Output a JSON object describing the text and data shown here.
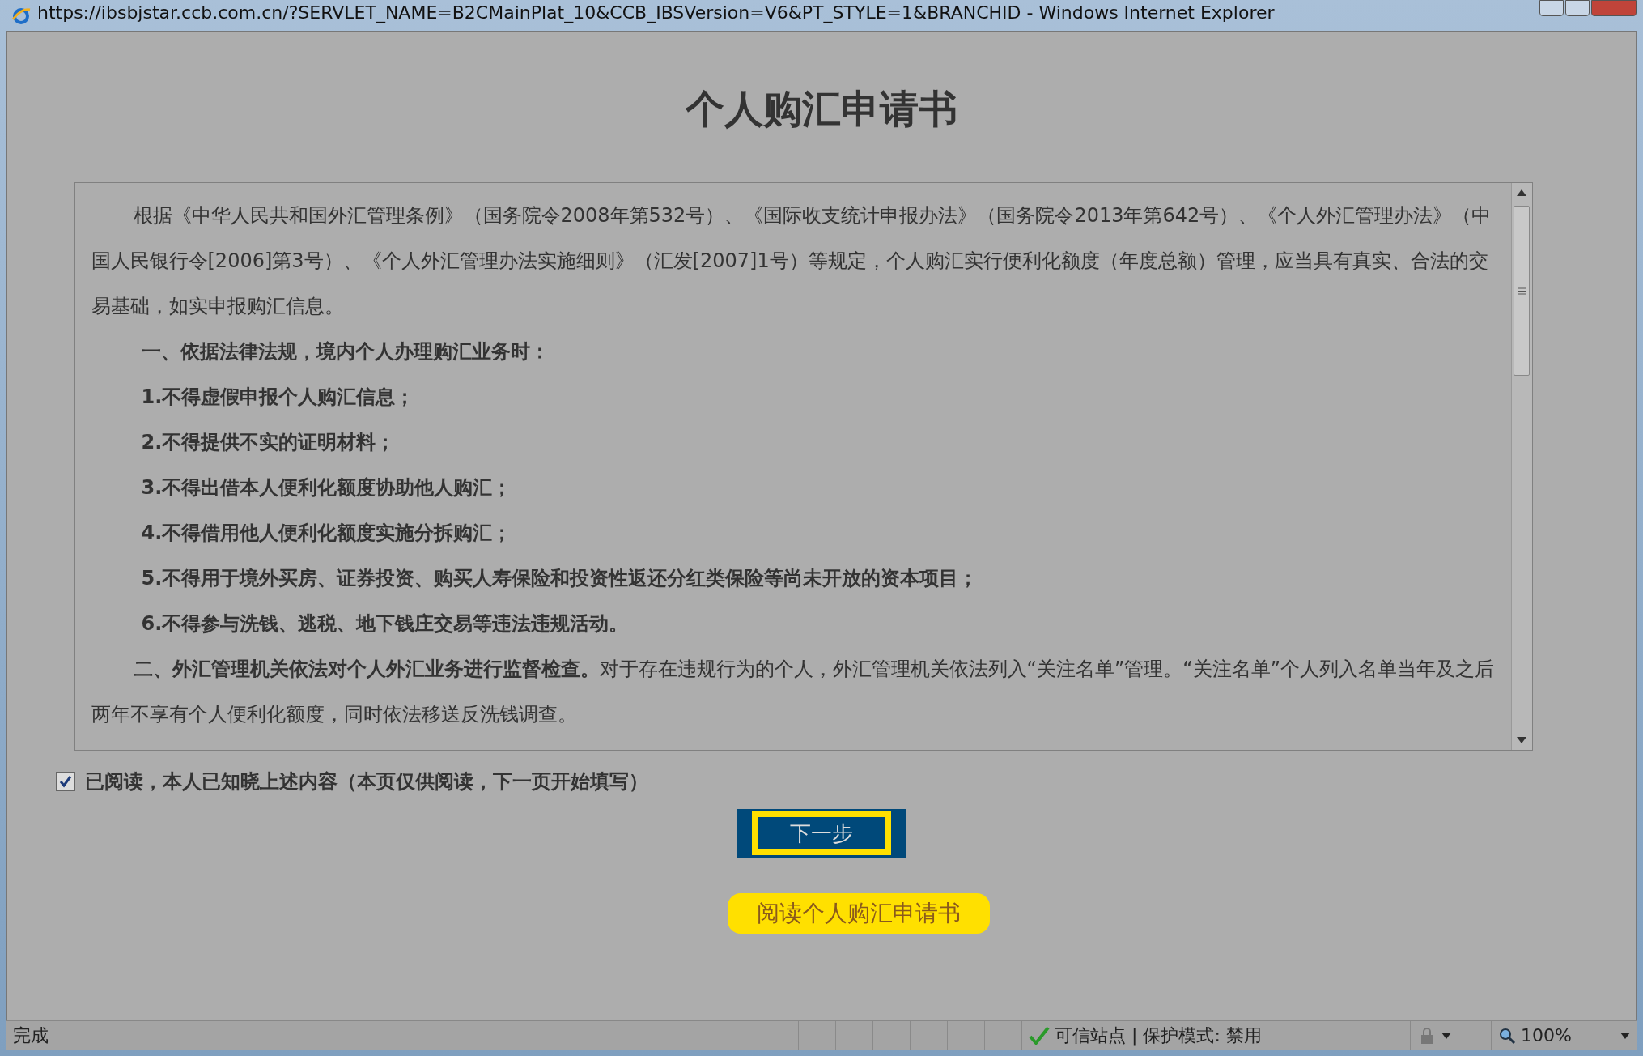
{
  "window": {
    "title": "https://ibsbjstar.ccb.com.cn/?SERVLET_NAME=B2CMainPlat_10&CCB_IBSVersion=V6&PT_STYLE=1&BRANCHID - Windows Internet Explorer"
  },
  "heading": "个人购汇申请书",
  "document": {
    "paragraphs": [
      {
        "kind": "plain",
        "text": "根据《中华人民共和国外汇管理条例》（国务院令2008年第532号）、《国际收支统计申报办法》（国务院令2013年第642号）、《个人外汇管理办法》（中国人民银行令[2006]第3号）、《个人外汇管理办法实施细则》（汇发[2007]1号）等规定，个人购汇实行便利化额度（年度总额）管理，应当具有真实、合法的交易基础，如实申报购汇信息。"
      },
      {
        "kind": "bold",
        "text": "一、依据法律法规，境内个人办理购汇业务时："
      },
      {
        "kind": "bold",
        "text": "1.不得虚假申报个人购汇信息；"
      },
      {
        "kind": "bold",
        "text": "2.不得提供不实的证明材料；"
      },
      {
        "kind": "bold",
        "text": "3.不得出借本人便利化额度协助他人购汇；"
      },
      {
        "kind": "bold",
        "text": "4.不得借用他人便利化额度实施分拆购汇；"
      },
      {
        "kind": "bold",
        "text": "5.不得用于境外买房、证券投资、购买人寿保险和投资性返还分红类保险等尚未开放的资本项目；"
      },
      {
        "kind": "bold",
        "text": "6.不得参与洗钱、逃税、地下钱庄交易等违法违规活动。"
      },
      {
        "kind": "plain",
        "text": "**二、外汇管理机关依法对个人外汇业务进行监督检查。**对于存在违规行为的个人，外汇管理机关依法列入“关注名单”管理。“关注名单”个人列入名单当年及之后两年不享有个人便利化额度，同时依法移送反洗钱调查。"
      }
    ]
  },
  "agreement": {
    "label": "已阅读，本人已知晓上述内容（本页仅供阅读，下一页开始填写）",
    "checked": true
  },
  "next_button": "下一步",
  "read_button": "阅读个人购汇申请书",
  "status_bar": {
    "status": "完成",
    "security": "可信站点 | 保护模式: 禁用",
    "zoom": "100%"
  }
}
